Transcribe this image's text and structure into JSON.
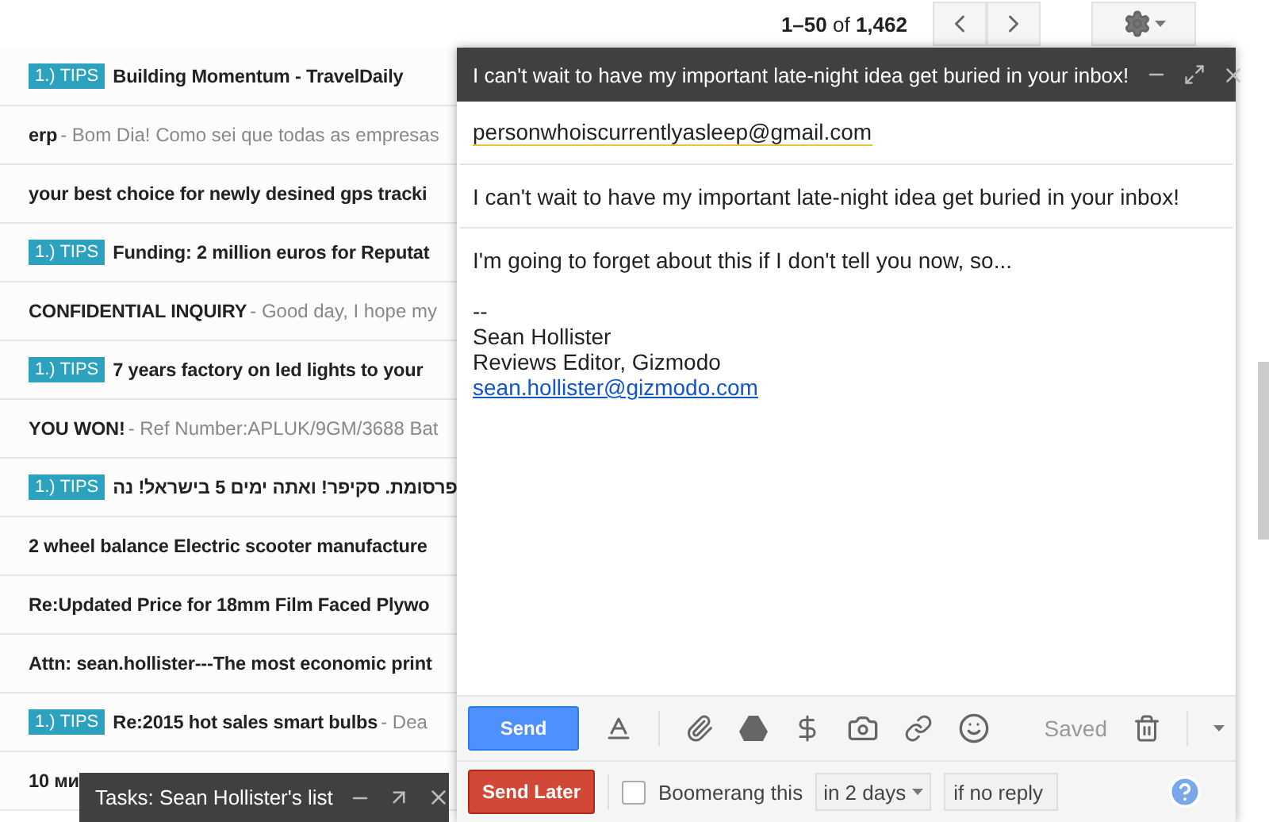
{
  "pager": {
    "range": "**1–50** of **1,462**"
  },
  "messages": [
    {
      "label": "1.) TIPS",
      "subject": "Building Momentum - TravelDaily"
    },
    {
      "subject": "erp",
      "snippet": "- Bom Dia! Como sei que todas as empresas"
    },
    {
      "subject": "your best choice for newly desined gps tracki"
    },
    {
      "label": "1.) TIPS",
      "subject": "Funding: 2 million euros for Reputat"
    },
    {
      "subject": "CONFIDENTIAL INQUIRY",
      "snippet": "- Good day, I hope my"
    },
    {
      "label": "1.) TIPS",
      "subject": "7 years factory on led lights to your"
    },
    {
      "subject": "YOU WON!",
      "snippet": "- Ref Number:APLUK/9GM/3688 Bat"
    },
    {
      "label": "1.) TIPS",
      "subject": "פרסומת. סקיפר! ואתה ימים 5 בישראל! נה"
    },
    {
      "subject": "2 wheel balance Electric scooter manufacture"
    },
    {
      "subject": "Re:Updated Price for 18mm Film Faced Plywo"
    },
    {
      "subject": "Attn: sean.hollister---The most economic print"
    },
    {
      "label": "1.) TIPS",
      "subject": "Re:2015 hot sales smart bulbs",
      "snippet": "- Dea"
    },
    {
      "subject": "10 ми"
    }
  ],
  "compose": {
    "title": "I can't wait to have my important late-night idea get buried in your inbox!",
    "to": "personwhoiscurrentlyasleep@gmail.com",
    "subject": "I can't wait to have my important late-night idea get buried in your inbox!",
    "intro": "I'm going to forget about this if I don't tell you now, so...",
    "signature": [
      "--",
      "Sean Hollister",
      "Reviews Editor, Gizmodo"
    ],
    "signature_link": "sean.hollister@gizmodo.com",
    "send": "Send",
    "status": "Saved",
    "send_later": "Send Later",
    "boomerang": {
      "label": "Boomerang this",
      "checked": false,
      "delay": "in 2 days",
      "condition": "if no reply"
    }
  },
  "tasks": {
    "title": "Tasks: Sean Hollister's list"
  }
}
